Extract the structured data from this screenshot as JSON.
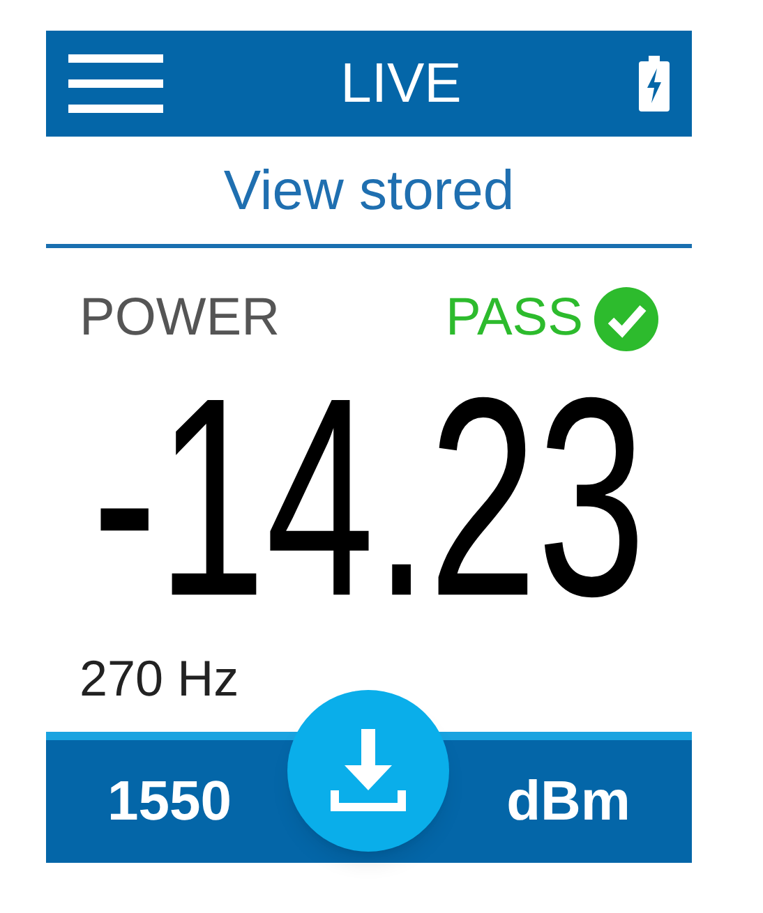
{
  "header": {
    "title": "LIVE"
  },
  "view_stored": "View stored",
  "measurement": {
    "label": "POWER",
    "result": {
      "text": "PASS",
      "passed": true
    },
    "value": "-14.23",
    "frequency": "270 Hz"
  },
  "bottom_bar": {
    "wavelength": "1550",
    "unit": "dBm"
  }
}
